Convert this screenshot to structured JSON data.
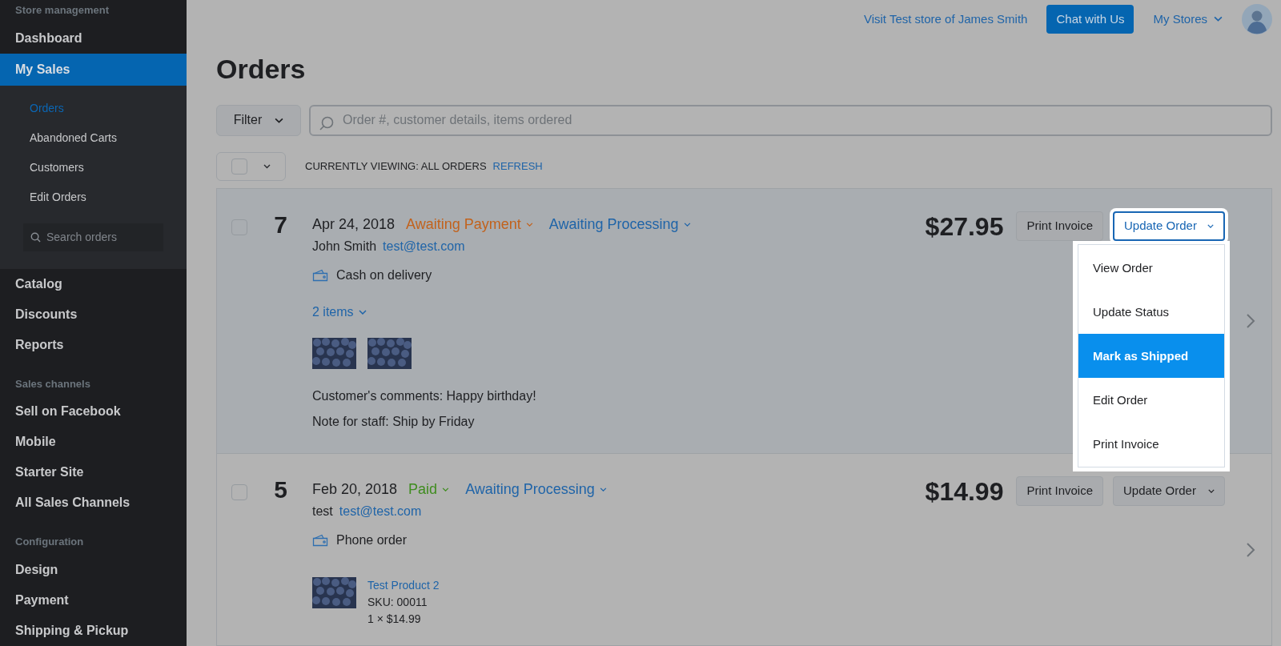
{
  "sidebar": {
    "sections": [
      {
        "heading": "Store management",
        "items": [
          {
            "label": "Dashboard",
            "selected": false
          },
          {
            "label": "My Sales",
            "selected": true,
            "children": [
              {
                "label": "Orders",
                "selected": true
              },
              {
                "label": "Abandoned Carts",
                "selected": false
              },
              {
                "label": "Customers",
                "selected": false
              },
              {
                "label": "Edit Orders",
                "selected": false
              }
            ],
            "search": {
              "placeholder": "Search orders"
            }
          },
          {
            "label": "Catalog",
            "selected": false
          },
          {
            "label": "Discounts",
            "selected": false
          },
          {
            "label": "Reports",
            "selected": false
          }
        ]
      },
      {
        "heading": "Sales channels",
        "items": [
          {
            "label": "Sell on Facebook",
            "selected": false
          },
          {
            "label": "Mobile",
            "selected": false
          },
          {
            "label": "Starter Site",
            "selected": false
          },
          {
            "label": "All Sales Channels",
            "selected": false
          }
        ]
      },
      {
        "heading": "Configuration",
        "items": [
          {
            "label": "Design",
            "selected": false
          },
          {
            "label": "Payment",
            "selected": false
          },
          {
            "label": "Shipping & Pickup",
            "selected": false
          }
        ]
      }
    ]
  },
  "header": {
    "store_link": "Visit Test store of James Smith",
    "chat_button": "Chat with Us",
    "stores_menu": "My Stores"
  },
  "page_title": "Orders",
  "filter": {
    "label": "Filter"
  },
  "search": {
    "placeholder": "Order #, customer details, items ordered"
  },
  "list_bar": {
    "select_all_checked": false,
    "viewing": "CURRENTLY VIEWING: ALL ORDERS",
    "refresh": "REFRESH"
  },
  "orders": [
    {
      "number": "7",
      "date": "Apr 24, 2018",
      "highlighted": true,
      "checked": false,
      "payment_status": {
        "label": "Awaiting Payment",
        "color": "#c2621c"
      },
      "fulfillment_status": {
        "label": "Awaiting Processing",
        "color": "#1f64a8"
      },
      "customer": "John Smith",
      "email": "test@test.com",
      "method": "Cash on delivery",
      "items_toggle": "2 items",
      "comments": "Customer's comments: Happy birthday!",
      "note": "Note for staff: Ship by Friday",
      "total": "$27.95",
      "print_button": "Print Invoice",
      "update_button": "Update Order",
      "menu_open": true,
      "menu": [
        {
          "label": "View Order",
          "selected": false
        },
        {
          "label": "Update Status",
          "selected": false
        },
        {
          "label": "Mark as Shipped",
          "selected": true
        },
        {
          "label": "Edit Order",
          "selected": false
        },
        {
          "label": "Print Invoice",
          "selected": false
        }
      ]
    },
    {
      "number": "5",
      "date": "Feb 20, 2018",
      "highlighted": false,
      "checked": false,
      "payment_status": {
        "label": "Paid",
        "color": "#3f8c1f"
      },
      "fulfillment_status": {
        "label": "Awaiting Processing",
        "color": "#1f64a8"
      },
      "customer": "test",
      "email": "test@test.com",
      "method": "Phone order",
      "products": [
        {
          "kind": "product",
          "name": "Test Product 2",
          "sku": "SKU: 00011",
          "qty_price": "1 × $14.99"
        }
      ],
      "total": "$14.99",
      "print_button": "Print Invoice",
      "update_button": "Update Order",
      "menu_open": false
    }
  ]
}
